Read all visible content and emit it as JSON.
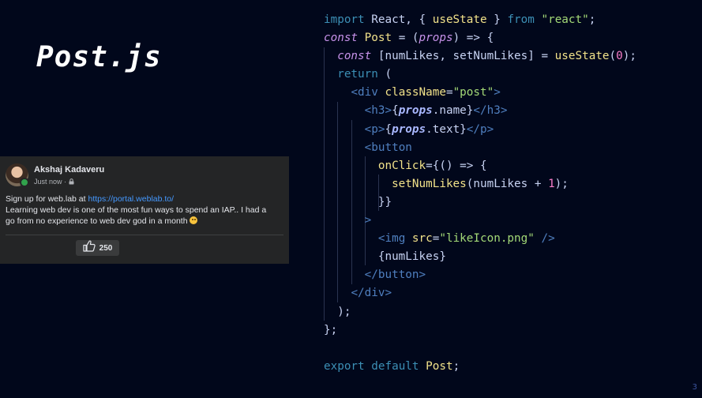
{
  "slide": {
    "title": "Post.js",
    "page_number": "3"
  },
  "post": {
    "author": "Akshaj Kadaveru",
    "timestamp": "Just now ·",
    "text_prefix": "Sign up for web.lab at ",
    "link": "https://portal.weblab.to/",
    "body_line1": "Learning web dev is one of the most fun ways to spend an IAP.. I had a",
    "body_line2": "go from no experience to web dev god in a month",
    "like_count": "250",
    "colors": {
      "card_bg": "#242526",
      "link": "#4599ff",
      "online": "#31a24c"
    }
  },
  "code": {
    "lines": [
      [
        {
          "t": "import",
          "c": "kw"
        },
        {
          "t": " React, { ",
          "c": "punc"
        },
        {
          "t": "useState",
          "c": "fn"
        },
        {
          "t": " } ",
          "c": "punc"
        },
        {
          "t": "from",
          "c": "kw"
        },
        {
          "t": " ",
          "c": "punc"
        },
        {
          "t": "\"react\"",
          "c": "str"
        },
        {
          "t": ";",
          "c": "punc"
        }
      ],
      [
        {
          "t": "const",
          "c": "kw2"
        },
        {
          "t": " ",
          "c": "punc"
        },
        {
          "t": "Post",
          "c": "fn"
        },
        {
          "t": " = (",
          "c": "punc"
        },
        {
          "t": "props",
          "c": "kw2"
        },
        {
          "t": ") => {",
          "c": "punc"
        }
      ],
      [
        {
          "t": "  ",
          "c": "punc"
        },
        {
          "t": "const",
          "c": "kw2"
        },
        {
          "t": " [numLikes, setNumLikes] = ",
          "c": "punc"
        },
        {
          "t": "useState",
          "c": "fn"
        },
        {
          "t": "(",
          "c": "punc"
        },
        {
          "t": "0",
          "c": "num"
        },
        {
          "t": ");",
          "c": "punc"
        }
      ],
      [
        {
          "t": "  ",
          "c": "punc"
        },
        {
          "t": "return",
          "c": "kw"
        },
        {
          "t": " (",
          "c": "punc"
        }
      ],
      [
        {
          "t": "    ",
          "c": "punc"
        },
        {
          "t": "<div",
          "c": "tag"
        },
        {
          "t": " ",
          "c": "punc"
        },
        {
          "t": "className",
          "c": "attr"
        },
        {
          "t": "=",
          "c": "punc"
        },
        {
          "t": "\"post\"",
          "c": "str"
        },
        {
          "t": ">",
          "c": "tag"
        }
      ],
      [
        {
          "t": "      ",
          "c": "punc"
        },
        {
          "t": "<h3>",
          "c": "tag"
        },
        {
          "t": "{",
          "c": "punc"
        },
        {
          "t": "props",
          "c": "ital"
        },
        {
          "t": ".name}",
          "c": "punc"
        },
        {
          "t": "</h3>",
          "c": "tag"
        }
      ],
      [
        {
          "t": "      ",
          "c": "punc"
        },
        {
          "t": "<p>",
          "c": "tag"
        },
        {
          "t": "{",
          "c": "punc"
        },
        {
          "t": "props",
          "c": "ital"
        },
        {
          "t": ".text}",
          "c": "punc"
        },
        {
          "t": "</p>",
          "c": "tag"
        }
      ],
      [
        {
          "t": "      ",
          "c": "punc"
        },
        {
          "t": "<button",
          "c": "tag"
        }
      ],
      [
        {
          "t": "        ",
          "c": "punc"
        },
        {
          "t": "onClick",
          "c": "attr"
        },
        {
          "t": "={() => {",
          "c": "punc"
        }
      ],
      [
        {
          "t": "          ",
          "c": "punc"
        },
        {
          "t": "setNumLikes",
          "c": "fn"
        },
        {
          "t": "(numLikes + ",
          "c": "punc"
        },
        {
          "t": "1",
          "c": "num"
        },
        {
          "t": ");",
          "c": "punc"
        }
      ],
      [
        {
          "t": "        }}",
          "c": "punc"
        }
      ],
      [
        {
          "t": "      ",
          "c": "punc"
        },
        {
          "t": ">",
          "c": "tag"
        }
      ],
      [
        {
          "t": "        ",
          "c": "punc"
        },
        {
          "t": "<img",
          "c": "tag"
        },
        {
          "t": " ",
          "c": "punc"
        },
        {
          "t": "src",
          "c": "attr"
        },
        {
          "t": "=",
          "c": "punc"
        },
        {
          "t": "\"likeIcon.png\"",
          "c": "str"
        },
        {
          "t": " />",
          "c": "tag"
        }
      ],
      [
        {
          "t": "        {numLikes}",
          "c": "punc"
        }
      ],
      [
        {
          "t": "      ",
          "c": "punc"
        },
        {
          "t": "</button>",
          "c": "tag"
        }
      ],
      [
        {
          "t": "    ",
          "c": "punc"
        },
        {
          "t": "</div>",
          "c": "tag"
        }
      ],
      [
        {
          "t": "  );",
          "c": "punc"
        }
      ],
      [
        {
          "t": "};",
          "c": "punc"
        }
      ],
      [
        {
          "t": "",
          "c": "punc"
        }
      ],
      [
        {
          "t": "export",
          "c": "kw"
        },
        {
          "t": " ",
          "c": "punc"
        },
        {
          "t": "default",
          "c": "kw"
        },
        {
          "t": " ",
          "c": "punc"
        },
        {
          "t": "Post",
          "c": "fn"
        },
        {
          "t": ";",
          "c": "punc"
        }
      ]
    ]
  }
}
